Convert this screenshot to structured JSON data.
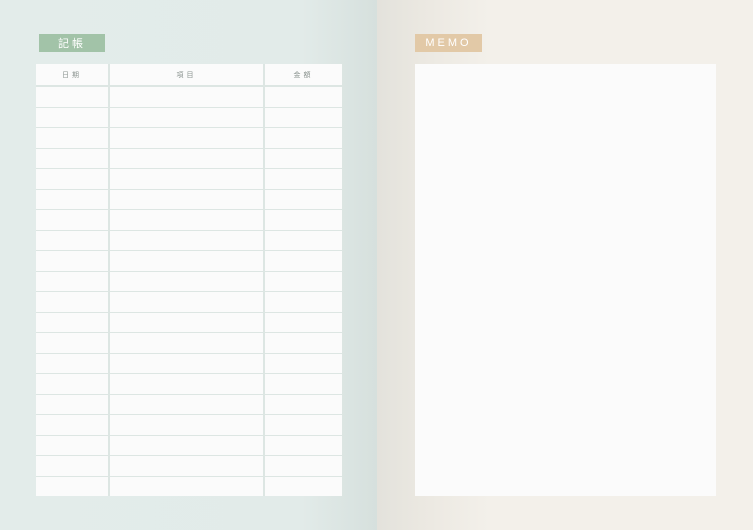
{
  "ledger": {
    "title": "記帳",
    "columns": [
      "日期",
      "項目",
      "金額"
    ],
    "row_count": 20
  },
  "memo": {
    "title": "MEMO"
  },
  "colors": {
    "ledger_tag": "#a2c3a8",
    "memo_tag": "#e2c9a7"
  }
}
